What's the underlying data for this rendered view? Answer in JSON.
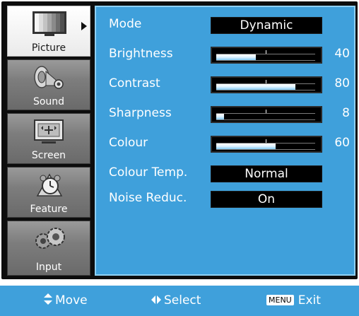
{
  "sidebar": {
    "items": [
      {
        "label": "Picture",
        "icon": "picture-icon",
        "active": true
      },
      {
        "label": "Sound",
        "icon": "speaker-icon",
        "active": false
      },
      {
        "label": "Screen",
        "icon": "screen-icon",
        "active": false
      },
      {
        "label": "Feature",
        "icon": "clock-icon",
        "active": false
      },
      {
        "label": "Input",
        "icon": "gears-icon",
        "active": false
      }
    ]
  },
  "settings": [
    {
      "name": "Mode",
      "type": "select",
      "value": "Dynamic"
    },
    {
      "name": "Brightness",
      "type": "slider",
      "value": 40,
      "max": 100
    },
    {
      "name": "Contrast",
      "type": "slider",
      "value": 80,
      "max": 100
    },
    {
      "name": "Sharpness",
      "type": "slider",
      "value": 8,
      "max": 100
    },
    {
      "name": "Colour",
      "type": "slider",
      "value": 60,
      "max": 100
    },
    {
      "name": "Colour Temp.",
      "type": "select",
      "value": "Normal"
    },
    {
      "name": "Noise Reduc.",
      "type": "select",
      "value": "On"
    }
  ],
  "footer": {
    "move": "Move",
    "select": "Select",
    "menu_key": "MENU",
    "exit": "Exit"
  },
  "colors": {
    "panel": "#3fa0db",
    "frame": "#0d0d0d"
  }
}
